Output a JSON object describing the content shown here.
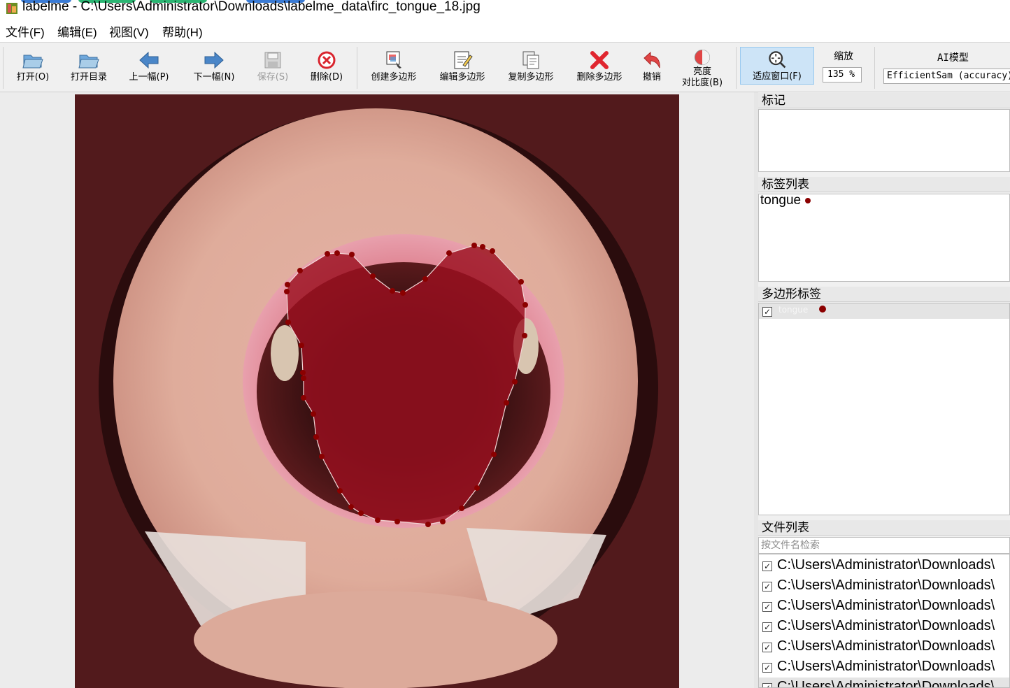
{
  "window": {
    "title": "labelme - C:\\Users\\Administrator\\Downloads\\labelme_data\\firc_tongue_18.jpg",
    "icon": "labelme-app-icon"
  },
  "menu": [
    "文件(F)",
    "编辑(E)",
    "视图(V)",
    "帮助(H)"
  ],
  "toolbar": {
    "open": "打开(O)",
    "open_dir": "打开目录",
    "prev": "上一幅(P)",
    "next": "下一幅(N)",
    "save": "保存(S)",
    "delete": "删除(D)",
    "create_polygon": "创建多边形",
    "edit_polygon": "编辑多边形",
    "copy_polygon": "复制多边形",
    "delete_polygon": "删除多边形",
    "undo": "撤销",
    "brightness_line1": "亮度",
    "brightness_line2": "对比度(B)",
    "fit_window": "适应窗口(F)",
    "zoom_label": "缩放",
    "zoom_value": "135 %",
    "ai_label": "AI模型",
    "ai_model": "EfficientSam (accuracy)"
  },
  "docks": {
    "flags_title": "标记",
    "label_list_title": "标签列表",
    "label_list": [
      {
        "name": "tongue",
        "color": "#8b0000"
      }
    ],
    "polygon_labels_title": "多边形标签",
    "polygon_labels": [
      {
        "name": "tongue",
        "checked": true,
        "color": "#8b0000"
      }
    ],
    "file_list_title": "文件列表",
    "file_search_placeholder": "按文件名检索",
    "files": [
      {
        "path": "C:\\Users\\Administrator\\Downloads\\",
        "checked": true
      },
      {
        "path": "C:\\Users\\Administrator\\Downloads\\",
        "checked": true
      },
      {
        "path": "C:\\Users\\Administrator\\Downloads\\",
        "checked": true
      },
      {
        "path": "C:\\Users\\Administrator\\Downloads\\",
        "checked": true
      },
      {
        "path": "C:\\Users\\Administrator\\Downloads\\",
        "checked": true
      },
      {
        "path": "C:\\Users\\Administrator\\Downloads\\",
        "checked": true
      },
      {
        "path": "C:\\Users\\Administrator\\Downloads\\",
        "checked": true
      }
    ]
  },
  "colors": {
    "polygon_fill": "#9b1020",
    "polygon_vertex": "#8b0000",
    "active_tool": "#cde4f7"
  }
}
